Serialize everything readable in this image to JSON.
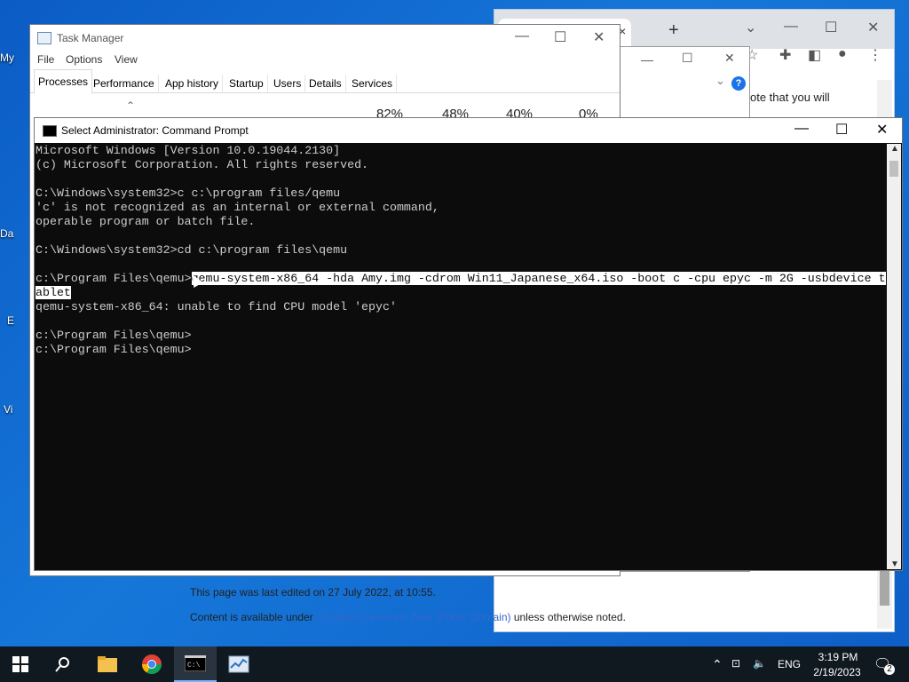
{
  "desktop": {
    "icon_labels": [
      "My",
      "Da",
      "E",
      "Vi"
    ]
  },
  "chrome": {
    "tab_close_glyph": "×",
    "newtab_glyph": "+",
    "content_snippet": "ote that you will",
    "footer_line1": "This page was last edited on 27 July 2022, at 10:55.",
    "footer_line2_prefix": "Content is available under ",
    "footer_line2_link": "Creative Commons Zero (Public Domain)",
    "footer_line2_suffix": " unless otherwise noted."
  },
  "task_manager": {
    "title": "Task Manager",
    "menu": [
      "File",
      "Options",
      "View"
    ],
    "tabs": [
      "Processes",
      "Performance",
      "App history",
      "Startup",
      "Users",
      "Details",
      "Services"
    ],
    "active_tab": "Processes",
    "percentages": [
      "82%",
      "48%",
      "40%",
      "0%"
    ]
  },
  "cmd": {
    "title": "Select Administrator: Command Prompt",
    "lines": [
      "Microsoft Windows [Version 10.0.19044.2130]",
      "(c) Microsoft Corporation. All rights reserved.",
      "",
      "C:\\Windows\\system32>c c:\\program files/qemu",
      "'c' is not recognized as an internal or external command,",
      "operable program or batch file.",
      "",
      "C:\\Windows\\system32>cd c:\\program files\\qemu",
      ""
    ],
    "prompt_before_selection": "c:\\Program Files\\qemu>",
    "selected_line1": "qemu-system-x86_64 -hda Amy.img -cdrom Win11_Japanese_x64.iso -boot c -cpu epyc -m 2G -usbdevice t",
    "selected_line2": "ablet",
    "lines_after": [
      "qemu-system-x86_64: unable to find CPU model 'epyc'",
      "",
      "c:\\Program Files\\qemu>",
      "c:\\Program Files\\qemu>"
    ]
  },
  "taskbar": {
    "language": "ENG",
    "time": "3:19 PM",
    "date": "2/19/2023",
    "notification_count": "2"
  }
}
